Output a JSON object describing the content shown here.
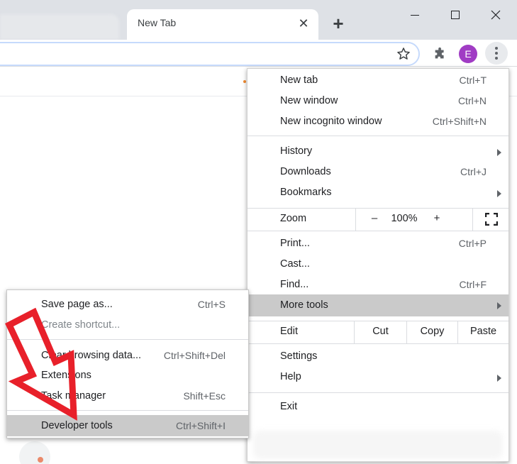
{
  "tab": {
    "title": "New Tab",
    "close": "✕",
    "new_tab": "+"
  },
  "window": {
    "minimize": "",
    "maximize": "",
    "close": "✕"
  },
  "toolbar": {
    "avatar_letter": "E"
  },
  "main_menu": {
    "new_tab": {
      "label": "New tab",
      "shortcut": "Ctrl+T"
    },
    "new_window": {
      "label": "New window",
      "shortcut": "Ctrl+N"
    },
    "new_incognito": {
      "label": "New incognito window",
      "shortcut": "Ctrl+Shift+N"
    },
    "history": {
      "label": "History"
    },
    "downloads": {
      "label": "Downloads",
      "shortcut": "Ctrl+J"
    },
    "bookmarks": {
      "label": "Bookmarks"
    },
    "zoom": {
      "label": "Zoom",
      "minus": "–",
      "value": "100%",
      "plus": "+"
    },
    "print": {
      "label": "Print...",
      "shortcut": "Ctrl+P"
    },
    "cast": {
      "label": "Cast..."
    },
    "find": {
      "label": "Find...",
      "shortcut": "Ctrl+F"
    },
    "more_tools": {
      "label": "More tools"
    },
    "edit": {
      "label": "Edit",
      "cut": "Cut",
      "copy": "Copy",
      "paste": "Paste"
    },
    "settings": {
      "label": "Settings"
    },
    "help": {
      "label": "Help"
    },
    "exit": {
      "label": "Exit"
    }
  },
  "more_tools_menu": {
    "save_page": {
      "label": "Save page as...",
      "shortcut": "Ctrl+S"
    },
    "create_shortcut": {
      "label": "Create shortcut..."
    },
    "clear_browsing": {
      "label": "Clear browsing data...",
      "shortcut": "Ctrl+Shift+Del"
    },
    "extensions": {
      "label": "Extensions"
    },
    "task_manager": {
      "label": "Task manager",
      "shortcut": "Shift+Esc"
    },
    "developer_tools": {
      "label": "Developer tools",
      "shortcut": "Ctrl+Shift+I"
    }
  },
  "colors": {
    "avatar": "#a03cc4",
    "highlight": "#cacaca",
    "annotation_arrow": "#e8202a"
  }
}
